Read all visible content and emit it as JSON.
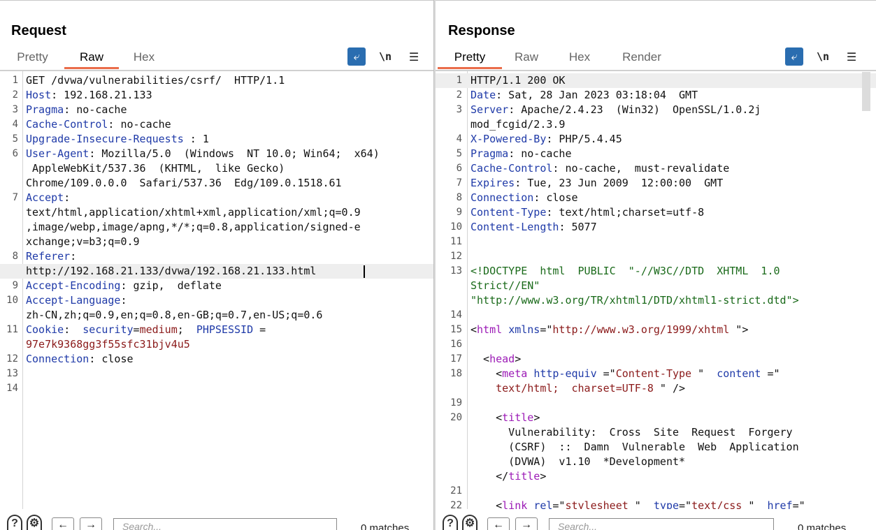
{
  "request": {
    "title": "Request",
    "tabs": [
      "Pretty",
      "Raw",
      "Hex"
    ],
    "active_tab": "Raw",
    "tools": {
      "wrap_icon": "wrap-text-icon",
      "newline_label": "\\n",
      "menu_icon": "hamburger-menu-icon"
    },
    "lines": [
      {
        "n": "1",
        "parts": [
          {
            "c": "",
            "t": "GET /dvwa/vulnerabilities/csrf/  HTTP/1.1"
          }
        ]
      },
      {
        "n": "2",
        "parts": [
          {
            "c": "k",
            "t": "Host"
          },
          {
            "c": "",
            "t": ": 192.168.21.133"
          }
        ]
      },
      {
        "n": "3",
        "parts": [
          {
            "c": "k",
            "t": "Pragma"
          },
          {
            "c": "",
            "t": ": no-cache"
          }
        ]
      },
      {
        "n": "4",
        "parts": [
          {
            "c": "k",
            "t": "Cache-Control"
          },
          {
            "c": "",
            "t": ": no-cache"
          }
        ]
      },
      {
        "n": "5",
        "parts": [
          {
            "c": "k",
            "t": "Upgrade-Insecure-Requests"
          },
          {
            "c": "",
            "t": " : 1"
          }
        ]
      },
      {
        "n": "6",
        "parts": [
          {
            "c": "k",
            "t": "User-Agent"
          },
          {
            "c": "",
            "t": ": Mozilla/5.0  (Windows  NT 10.0; Win64;  x64)"
          }
        ]
      },
      {
        "n": "",
        "parts": [
          {
            "c": "",
            "t": " AppleWebKit/537.36  (KHTML,  like Gecko)"
          }
        ]
      },
      {
        "n": "",
        "parts": [
          {
            "c": "",
            "t": "Chrome/109.0.0.0  Safari/537.36  Edg/109.0.1518.61"
          }
        ]
      },
      {
        "n": "7",
        "parts": [
          {
            "c": "k",
            "t": "Accept"
          },
          {
            "c": "",
            "t": ":"
          }
        ]
      },
      {
        "n": "",
        "parts": [
          {
            "c": "",
            "t": "text/html,application/xhtml+xml,application/xml;q=0.9"
          }
        ]
      },
      {
        "n": "",
        "parts": [
          {
            "c": "",
            "t": ",image/webp,image/apng,*/*;q=0.8,application/signed-e"
          }
        ]
      },
      {
        "n": "",
        "parts": [
          {
            "c": "",
            "t": "xchange;v=b3;q=0.9"
          }
        ]
      },
      {
        "n": "8",
        "parts": [
          {
            "c": "k",
            "t": "Referer"
          },
          {
            "c": "",
            "t": ":"
          }
        ]
      },
      {
        "n": "",
        "parts": [
          {
            "c": "",
            "t": "http://192.168.21.133/dvwa/192.168.21.133.html"
          }
        ],
        "hl": true
      },
      {
        "n": "9",
        "parts": [
          {
            "c": "k",
            "t": "Accept-Encoding"
          },
          {
            "c": "",
            "t": ": gzip,  deflate"
          }
        ]
      },
      {
        "n": "10",
        "parts": [
          {
            "c": "k",
            "t": "Accept-Language"
          },
          {
            "c": "",
            "t": ":"
          }
        ]
      },
      {
        "n": "",
        "parts": [
          {
            "c": "",
            "t": "zh-CN,zh;q=0.9,en;q=0.8,en-GB;q=0.7,en-US;q=0.6"
          }
        ]
      },
      {
        "n": "11",
        "parts": [
          {
            "c": "k",
            "t": "Cookie"
          },
          {
            "c": "",
            "t": ":  "
          },
          {
            "c": "k",
            "t": "security"
          },
          {
            "c": "",
            "t": "="
          },
          {
            "c": "v",
            "t": "medium"
          },
          {
            "c": "",
            "t": ";  "
          },
          {
            "c": "k",
            "t": "PHPSESSID"
          },
          {
            "c": "",
            "t": " ="
          }
        ]
      },
      {
        "n": "",
        "parts": [
          {
            "c": "v",
            "t": "97e7k9368gg3f55sfc31bjv4u5"
          }
        ]
      },
      {
        "n": "12",
        "parts": [
          {
            "c": "k",
            "t": "Connection"
          },
          {
            "c": "",
            "t": ": close"
          }
        ]
      },
      {
        "n": "13",
        "parts": []
      },
      {
        "n": "14",
        "parts": []
      }
    ],
    "bottom": {
      "search_placeholder": "Search...",
      "matches": "0 matches"
    }
  },
  "response": {
    "title": "Response",
    "tabs": [
      "Pretty",
      "Raw",
      "Hex",
      "Render"
    ],
    "active_tab": "Pretty",
    "tools": {
      "wrap_icon": "wrap-text-icon",
      "newline_label": "\\n",
      "menu_icon": "hamburger-menu-icon"
    },
    "lines": [
      {
        "n": "1",
        "parts": [
          {
            "c": "",
            "t": "HTTP/1.1 200 OK"
          }
        ],
        "hl": true
      },
      {
        "n": "2",
        "parts": [
          {
            "c": "k",
            "t": "Date"
          },
          {
            "c": "",
            "t": ": Sat, 28 Jan 2023 03:18:04  GMT"
          }
        ]
      },
      {
        "n": "3",
        "parts": [
          {
            "c": "k",
            "t": "Server"
          },
          {
            "c": "",
            "t": ": Apache/2.4.23  (Win32)  OpenSSL/1.0.2j"
          }
        ]
      },
      {
        "n": "",
        "parts": [
          {
            "c": "",
            "t": "mod_fcgid/2.3.9"
          }
        ]
      },
      {
        "n": "4",
        "parts": [
          {
            "c": "k",
            "t": "X-Powered-By"
          },
          {
            "c": "",
            "t": ": PHP/5.4.45"
          }
        ]
      },
      {
        "n": "5",
        "parts": [
          {
            "c": "k",
            "t": "Pragma"
          },
          {
            "c": "",
            "t": ": no-cache"
          }
        ]
      },
      {
        "n": "6",
        "parts": [
          {
            "c": "k",
            "t": "Cache-Control"
          },
          {
            "c": "",
            "t": ": no-cache,  must-revalidate"
          }
        ]
      },
      {
        "n": "7",
        "parts": [
          {
            "c": "k",
            "t": "Expires"
          },
          {
            "c": "",
            "t": ": Tue, 23 Jun 2009  12:00:00  GMT"
          }
        ]
      },
      {
        "n": "8",
        "parts": [
          {
            "c": "k",
            "t": "Connection"
          },
          {
            "c": "",
            "t": ": close"
          }
        ]
      },
      {
        "n": "9",
        "parts": [
          {
            "c": "k",
            "t": "Content-Type"
          },
          {
            "c": "",
            "t": ": text/html;charset=utf-8"
          }
        ]
      },
      {
        "n": "10",
        "parts": [
          {
            "c": "k",
            "t": "Content-Length"
          },
          {
            "c": "",
            "t": ": 5077"
          }
        ]
      },
      {
        "n": "11",
        "parts": []
      },
      {
        "n": "12",
        "parts": []
      },
      {
        "n": "13",
        "parts": [
          {
            "c": "s",
            "t": "<!DOCTYPE  html  PUBLIC  \"-//W3C//DTD  XHTML  1.0"
          }
        ]
      },
      {
        "n": "",
        "parts": [
          {
            "c": "s",
            "t": "Strict//EN\""
          }
        ]
      },
      {
        "n": "",
        "parts": [
          {
            "c": "s",
            "t": "\"http://www.w3.org/TR/xhtml1/DTD/xhtml1-strict.dtd\">"
          }
        ]
      },
      {
        "n": "14",
        "parts": []
      },
      {
        "n": "15",
        "parts": [
          {
            "c": "",
            "t": "<"
          },
          {
            "c": "t",
            "t": "html"
          },
          {
            "c": "",
            "t": " "
          },
          {
            "c": "k",
            "t": "xmlns"
          },
          {
            "c": "",
            "t": "=\""
          },
          {
            "c": "v",
            "t": "http://www.w3.org/1999/xhtml"
          },
          {
            "c": "",
            "t": " \">"
          }
        ]
      },
      {
        "n": "16",
        "parts": []
      },
      {
        "n": "17",
        "parts": [
          {
            "c": "",
            "t": "  <"
          },
          {
            "c": "t",
            "t": "head"
          },
          {
            "c": "",
            "t": ">"
          }
        ]
      },
      {
        "n": "18",
        "parts": [
          {
            "c": "",
            "t": "    <"
          },
          {
            "c": "t",
            "t": "meta"
          },
          {
            "c": "",
            "t": " "
          },
          {
            "c": "k",
            "t": "http-equiv"
          },
          {
            "c": "",
            "t": " =\""
          },
          {
            "c": "v",
            "t": "Content-Type"
          },
          {
            "c": "",
            "t": " \"  "
          },
          {
            "c": "k",
            "t": "content"
          },
          {
            "c": "",
            "t": " =\""
          }
        ]
      },
      {
        "n": "",
        "parts": [
          {
            "c": "v",
            "t": "    text/html;  charset=UTF-8"
          },
          {
            "c": "",
            "t": " \" />"
          }
        ]
      },
      {
        "n": "19",
        "parts": []
      },
      {
        "n": "20",
        "parts": [
          {
            "c": "",
            "t": "    <"
          },
          {
            "c": "t",
            "t": "title"
          },
          {
            "c": "",
            "t": ">"
          }
        ]
      },
      {
        "n": "",
        "parts": [
          {
            "c": "",
            "t": "      Vulnerability:  Cross  Site  Request  Forgery"
          }
        ]
      },
      {
        "n": "",
        "parts": [
          {
            "c": "",
            "t": "      (CSRF)  ::  Damn  Vulnerable  Web  Application"
          }
        ]
      },
      {
        "n": "",
        "parts": [
          {
            "c": "",
            "t": "      (DVWA)  v1.10  *Development*"
          }
        ]
      },
      {
        "n": "",
        "parts": [
          {
            "c": "",
            "t": "    </"
          },
          {
            "c": "t",
            "t": "title"
          },
          {
            "c": "",
            "t": ">"
          }
        ]
      },
      {
        "n": "21",
        "parts": []
      },
      {
        "n": "22",
        "parts": [
          {
            "c": "",
            "t": "    <"
          },
          {
            "c": "t",
            "t": "link"
          },
          {
            "c": "",
            "t": " "
          },
          {
            "c": "k",
            "t": "rel"
          },
          {
            "c": "",
            "t": "=\""
          },
          {
            "c": "v",
            "t": "stylesheet"
          },
          {
            "c": "",
            "t": " \"  "
          },
          {
            "c": "k",
            "t": "type"
          },
          {
            "c": "",
            "t": "=\""
          },
          {
            "c": "v",
            "t": "text/css"
          },
          {
            "c": "",
            "t": " \"  "
          },
          {
            "c": "k",
            "t": "href"
          },
          {
            "c": "",
            "t": "=\""
          }
        ]
      }
    ],
    "bottom": {
      "search_placeholder": "Search...",
      "matches": "0 matches"
    }
  },
  "view_toggle": {
    "options": [
      "side-by-side",
      "stacked",
      "single"
    ],
    "active": "side-by-side"
  },
  "colors": {
    "accent_tab": "#ea6d4a",
    "active_tool": "#2a6db0",
    "header_key": "#1f3aa8",
    "value": "#8b1a1a",
    "tag": "#9c1bb6",
    "doctype": "#1a6a1a"
  }
}
